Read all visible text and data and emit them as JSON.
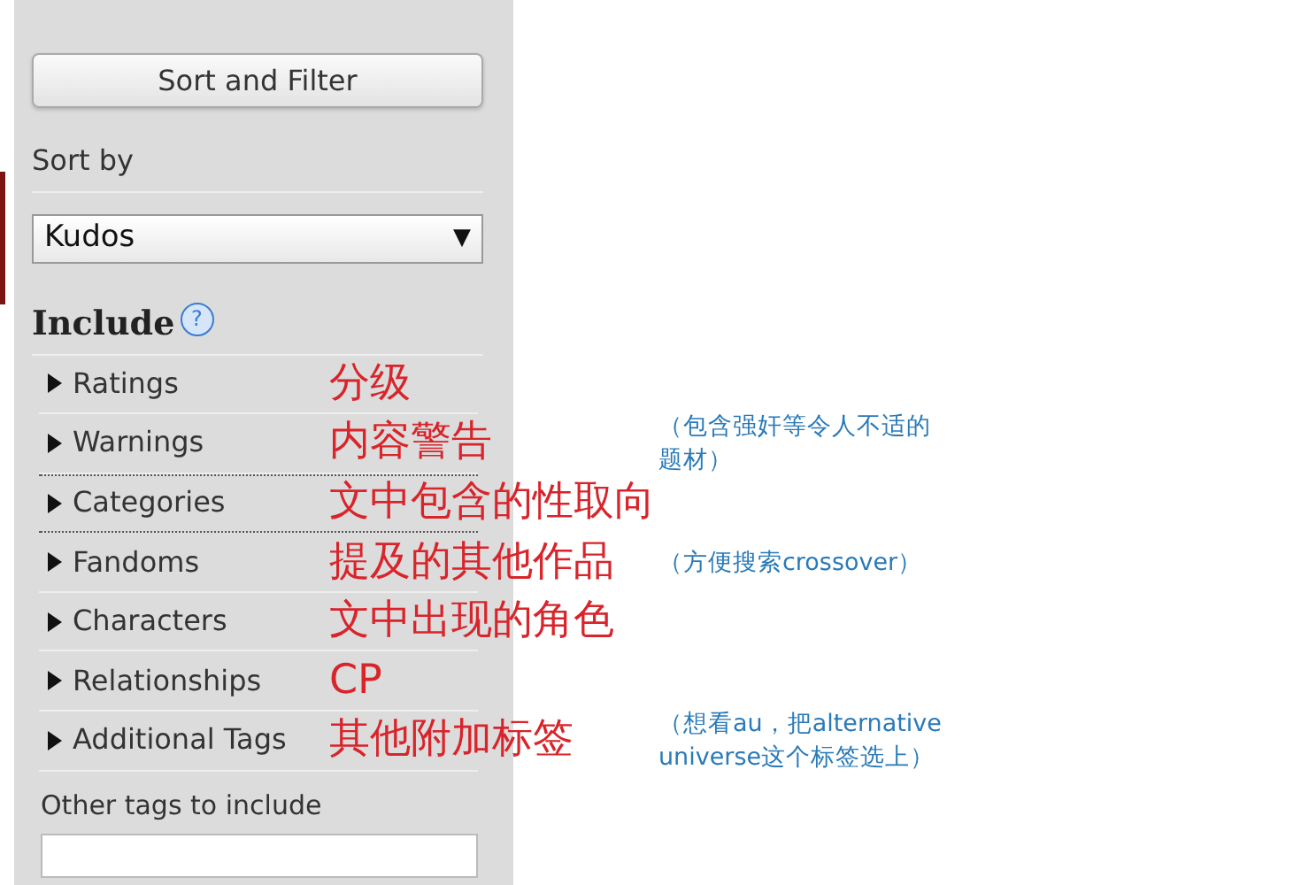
{
  "sort_filter_button": "Sort and Filter",
  "sort_by": {
    "label": "Sort by",
    "value": "Kudos",
    "caret": "▼"
  },
  "include": {
    "heading": "Include",
    "help": "?",
    "filters": [
      {
        "label": "Ratings",
        "expanded": false,
        "focused": false,
        "note": "分级"
      },
      {
        "label": "Warnings",
        "expanded": false,
        "focused": false,
        "note": "内容警告",
        "comment": "（包含强奸等令人不适的题材）"
      },
      {
        "label": "Categories",
        "expanded": false,
        "focused": true,
        "note": "文中包含的性取向"
      },
      {
        "label": "Fandoms",
        "expanded": false,
        "focused": false,
        "note": "提及的其他作品",
        "comment": "（方便搜索crossover）"
      },
      {
        "label": "Characters",
        "expanded": false,
        "focused": false,
        "note": "文中出现的角色"
      },
      {
        "label": "Relationships",
        "expanded": false,
        "focused": false,
        "note": "CP"
      },
      {
        "label": "Additional Tags",
        "expanded": false,
        "focused": false,
        "note": "其他附加标签",
        "comment": "（想看au，把alternative universe这个标签选上）"
      }
    ],
    "other_tags": {
      "label": "Other tags to include"
    }
  }
}
